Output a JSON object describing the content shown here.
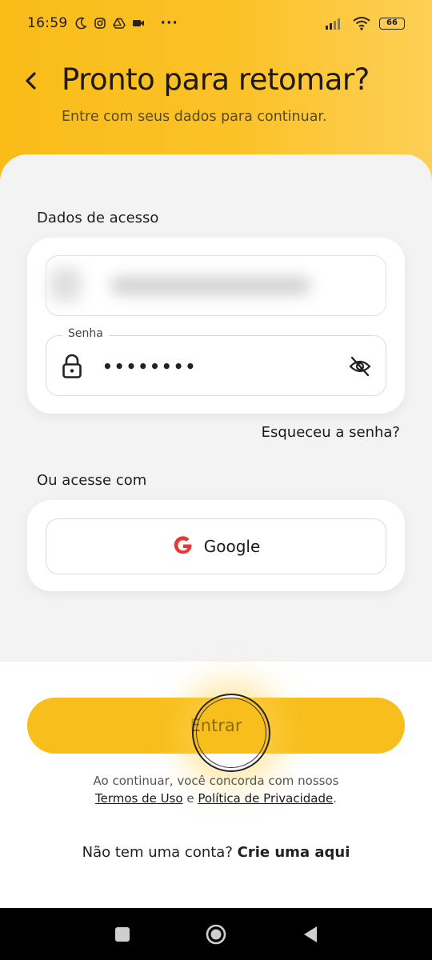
{
  "status_bar": {
    "time": "16:59",
    "battery": "66",
    "more": "···"
  },
  "header": {
    "title": "Pronto para retomar?",
    "subtitle": "Entre com seus dados para continuar."
  },
  "access": {
    "section_label": "Dados de acesso",
    "password_label": "Senha",
    "password_value": "••••••••",
    "forgot_link": "Esqueceu a senha?"
  },
  "social": {
    "section_label": "Ou acesse com",
    "google_label": "Google"
  },
  "footer": {
    "enter_label": "Entrar",
    "legal_prefix": "Ao continuar, você concorda com nossos",
    "terms_link": "Termos de Uso",
    "legal_and": " e ",
    "privacy_link": "Política de Privacidade",
    "legal_end": ".",
    "signup_prompt": "Não tem uma conta?",
    "signup_link": "Crie uma aqui"
  },
  "colors": {
    "accent": "#fbc02d",
    "button": "#f8bf1c",
    "sheet": "#f3f3f3",
    "google_red": "#e53935"
  },
  "icons": [
    "moon-icon",
    "instagram-icon",
    "drive-icon",
    "video-icon",
    "signal-icon",
    "wifi-icon",
    "battery-icon",
    "back-arrow-icon",
    "lock-icon",
    "eye-off-icon",
    "google-logo-icon",
    "square-nav-icon",
    "home-nav-icon",
    "back-nav-icon"
  ]
}
